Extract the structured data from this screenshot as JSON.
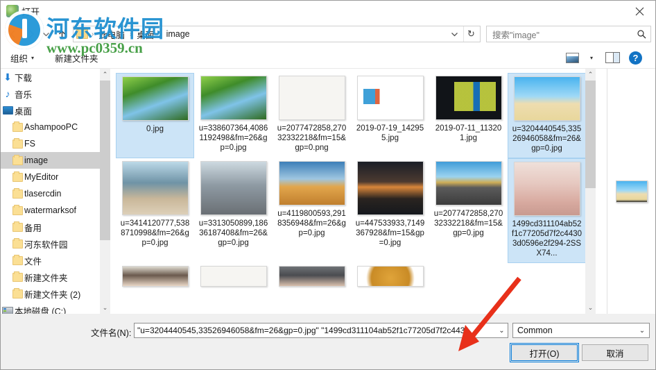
{
  "window": {
    "title": "打开",
    "close_label": "✕",
    "app_icon": "app-icon"
  },
  "nav": {
    "back": "‹",
    "forward": "›",
    "recent_caret": "⌄",
    "up": "↑",
    "address_dropdown": "⌄",
    "refresh": "↻",
    "breadcrumbs": [
      {
        "label": "此电脑"
      },
      {
        "label": "桌面"
      },
      {
        "label": "image"
      }
    ],
    "separator": "›"
  },
  "search": {
    "placeholder": "搜索\"image\"",
    "icon": "search-icon"
  },
  "toolbar": {
    "organize": "组织",
    "organize_caret": "▾",
    "new_folder": "新建文件夹",
    "view_caret": "▾",
    "help": "?"
  },
  "sidebar": {
    "scroll_up": "⌃",
    "scroll_down": "⌄",
    "items": [
      {
        "label": "下载",
        "icon": "download-icon",
        "indent": 16,
        "selected": false
      },
      {
        "label": "音乐",
        "icon": "music-icon",
        "indent": 16,
        "selected": false
      },
      {
        "label": "桌面",
        "icon": "desktop-icon",
        "indent": 16,
        "selected": false
      },
      {
        "label": "AshampooPC",
        "icon": "folder-icon",
        "indent": 30,
        "selected": false
      },
      {
        "label": "FS",
        "icon": "folder-icon",
        "indent": 30,
        "selected": false
      },
      {
        "label": "image",
        "icon": "folder-icon",
        "indent": 30,
        "selected": true
      },
      {
        "label": "MyEditor",
        "icon": "folder-icon",
        "indent": 30,
        "selected": false
      },
      {
        "label": "tlasercdin",
        "icon": "folder-icon",
        "indent": 30,
        "selected": false
      },
      {
        "label": "watermarksof",
        "icon": "folder-icon",
        "indent": 30,
        "selected": false
      },
      {
        "label": "备用",
        "icon": "folder-icon",
        "indent": 30,
        "selected": false
      },
      {
        "label": "河东软件园",
        "icon": "folder-icon",
        "indent": 30,
        "selected": false
      },
      {
        "label": "文件",
        "icon": "folder-icon",
        "indent": 30,
        "selected": false
      },
      {
        "label": "新建文件夹",
        "icon": "folder-icon",
        "indent": 30,
        "selected": false
      },
      {
        "label": "新建文件夹 (2)",
        "icon": "folder-icon",
        "indent": 30,
        "selected": false
      },
      {
        "label": "本地磁盘 (C:)",
        "icon": "disk-icon",
        "indent": 16,
        "selected": false
      }
    ]
  },
  "files": [
    {
      "name": "0.jpg",
      "art": "t-forest",
      "selected": true,
      "tall": false
    },
    {
      "name": "u=338607364,40861192498&fm=26&gp=0.jpg",
      "art": "t-forest",
      "selected": false,
      "tall": false
    },
    {
      "name": "u=2077472858,27032332218&fm=15&gp=0.png",
      "art": "t-blank",
      "selected": false,
      "tall": false
    },
    {
      "name": "2019-07-19_142955.jpg",
      "art": "t-logo",
      "selected": false,
      "tall": false
    },
    {
      "name": "2019-07-11_113201.jpg",
      "art": "t-win",
      "selected": false,
      "tall": false
    },
    {
      "name": "u=3204440545,33526946058&fm=26&gp=0.jpg",
      "art": "t-beach",
      "selected": true,
      "tall": false
    },
    {
      "name": "u=3414120777,5388710998&fm=26&gp=0.jpg",
      "art": "t-girl1",
      "selected": false,
      "tall": true
    },
    {
      "name": "u=3313050899,18636187408&fm=26&gp=0.jpg",
      "art": "t-girl2",
      "selected": false,
      "tall": true
    },
    {
      "name": "u=4119800593,2918356948&fm=26&gp=0.jpg",
      "art": "t-desert",
      "selected": false,
      "tall": false
    },
    {
      "name": "u=447533933,7149367928&fm=15&gp=0.jpg",
      "art": "t-road1",
      "selected": false,
      "tall": true
    },
    {
      "name": "u=2077472858,27032332218&fm=15&gp=0.jpg",
      "art": "t-road2",
      "selected": false,
      "tall": false
    },
    {
      "name": "1499cd311104ab52f1c77205d7f2c44303d0596e2f294-2SSX74...",
      "art": "t-bride",
      "selected": true,
      "tall": true
    }
  ],
  "files_partial_row": [
    {
      "art": "t-port1"
    },
    {
      "art": "t-blank"
    },
    {
      "art": "t-port2"
    },
    {
      "art": "t-gold"
    }
  ],
  "footer": {
    "filename_label": "文件名(N):",
    "filename_value": "\"u=3204440545,33526946058&fm=26&gp=0.jpg\" \"1499cd311104ab52f1c77205d7f2c443(",
    "filename_caret": "⌄",
    "filter_value": "Common",
    "filter_caret": "⌄",
    "open_button": "打开(O)",
    "cancel_button": "取消"
  },
  "watermark": {
    "text_cn": "河东软件园",
    "url": "www.pc0359.cn"
  },
  "colors": {
    "accent": "#0078d7",
    "selection": "#cce4f7",
    "watermark_blue": "#1e8fd0",
    "watermark_green": "#3f9b3f",
    "arrow_red": "#e8301a"
  }
}
